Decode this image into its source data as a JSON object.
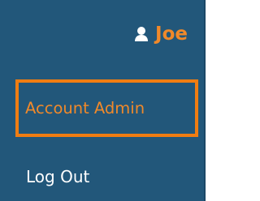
{
  "user": {
    "icon": "user-icon",
    "name": "Joe"
  },
  "menu": {
    "items": [
      {
        "label": "Account Admin",
        "highlighted": true
      },
      {
        "label": "Log Out",
        "highlighted": false
      }
    ]
  },
  "colors": {
    "panel_bg": "#22577a",
    "accent": "#f0892a",
    "highlight_border": "#f07d12",
    "text": "#ffffff"
  }
}
